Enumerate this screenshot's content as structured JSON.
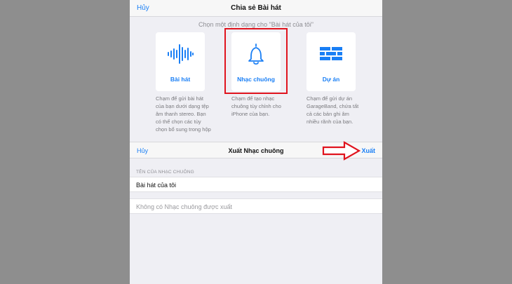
{
  "share_sheet": {
    "cancel_label": "Hủy",
    "title": "Chia sẻ Bài hát",
    "prompt": "Chọn một định dạng cho \"Bài hát của tôi\"",
    "options": [
      {
        "label": "Bài hát",
        "icon": "waveform-icon",
        "description": "Chạm để gửi bài hát của bạn dưới dạng tệp âm thanh stereo. Bạn có thể chọn các tùy chọn bổ sung trong hộp"
      },
      {
        "label": "Nhạc chuông",
        "icon": "bell-icon",
        "description": "Chạm để tạo nhạc chuông tùy chỉnh cho iPhone của bạn."
      },
      {
        "label": "Dự án",
        "icon": "brick-wall-icon",
        "description": "Chạm để gửi dự án GarageBand, chứa tất cả các bản ghi âm nhiều rãnh của bạn."
      }
    ]
  },
  "export_sheet": {
    "cancel_label": "Hủy",
    "title": "Xuất Nhạc chuông",
    "export_label": "Xuất",
    "section_header": "TÊN CỦA NHẠC CHUÔNG",
    "ringtone_name": "Bài hát của tôi",
    "empty_message": "Không có Nhạc chuông được xuất"
  },
  "colors": {
    "accent": "#1a7ff5",
    "annotation": "#e0141e",
    "backdrop": "#8e8e8e",
    "panel": "#efeff4"
  }
}
